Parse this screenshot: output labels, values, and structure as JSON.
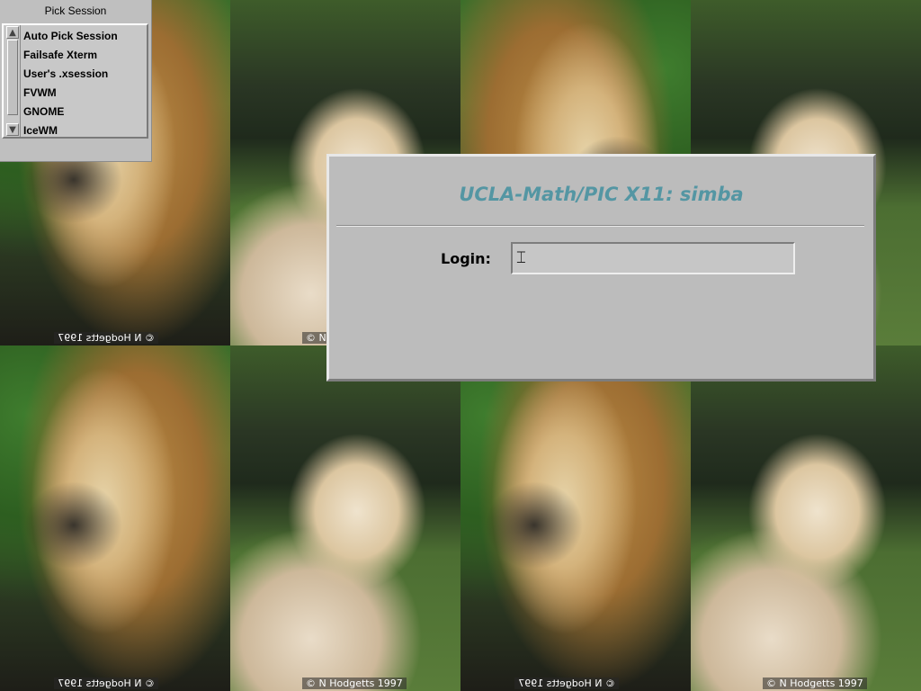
{
  "wallpaper": {
    "watermark": "© N Hodgetts 1997"
  },
  "session_panel": {
    "title": "Pick Session",
    "items": [
      {
        "label": "Auto Pick Session"
      },
      {
        "label": "Failsafe Xterm"
      },
      {
        "label": "User's .xsession"
      },
      {
        "label": "FVWM"
      },
      {
        "label": "GNOME"
      },
      {
        "label": "IceWM"
      }
    ],
    "scroll_up_icon": "▲",
    "scroll_down_icon": "▼"
  },
  "login_dialog": {
    "greeting": "UCLA-Math/PIC X11: simba",
    "login_label": "Login:",
    "login_value": "",
    "greeting_color": "#5496a3"
  }
}
